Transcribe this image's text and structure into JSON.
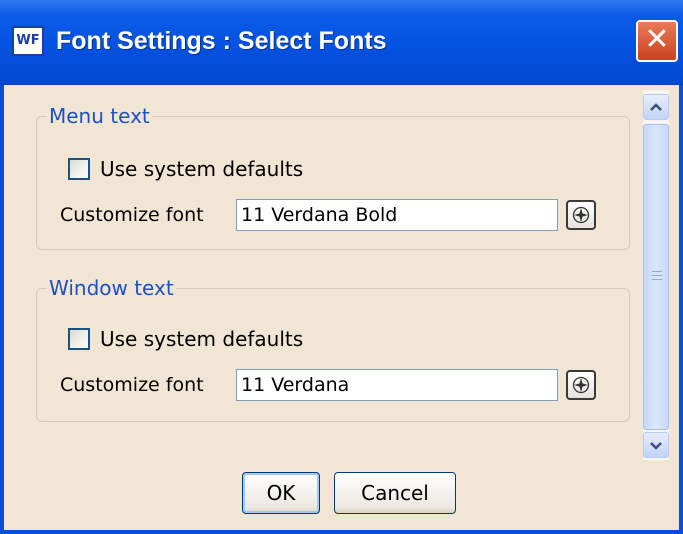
{
  "window": {
    "title": "Font Settings : Select Fonts",
    "app_icon_text": "WF",
    "close_glyph": "✕"
  },
  "groups": [
    {
      "legend": "Menu text",
      "use_system_defaults": {
        "label": "Use system defaults",
        "checked": false
      },
      "customize_font": {
        "label": "Customize font",
        "value": "11 Verdana Bold"
      },
      "font_button_icon": "font-picker-icon"
    },
    {
      "legend": "Window text",
      "use_system_defaults": {
        "label": "Use system defaults",
        "checked": false
      },
      "customize_font": {
        "label": "Customize font",
        "value": "11 Verdana"
      },
      "font_button_icon": "font-picker-icon"
    }
  ],
  "buttons": {
    "ok": "OK",
    "cancel": "Cancel"
  },
  "colors": {
    "titlebar": "#0452e0",
    "dialog_background": "#f1e6d4",
    "legend_text": "#1c50c4",
    "close_button": "#d45a35"
  }
}
